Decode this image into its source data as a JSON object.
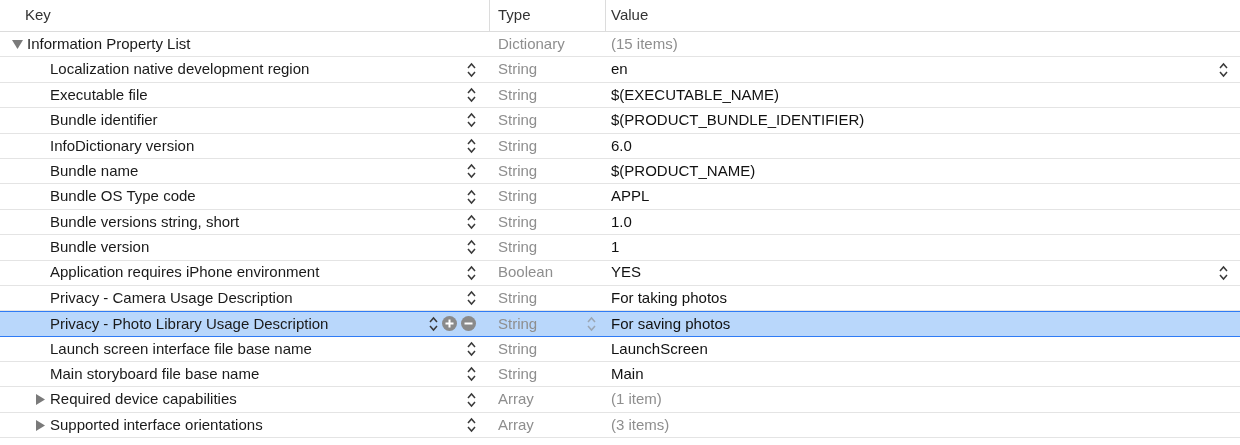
{
  "columns": [
    "Key",
    "Type",
    "Value"
  ],
  "root": {
    "key": "Information Property List",
    "type": "Dictionary",
    "value": "(15 items)",
    "expanded": true,
    "children": [
      {
        "key": "Localization native development region",
        "type": "String",
        "value": "en",
        "kind": "scalar",
        "selected": false,
        "value_popup": true
      },
      {
        "key": "Executable file",
        "type": "String",
        "value": "$(EXECUTABLE_NAME)",
        "kind": "scalar",
        "selected": false,
        "value_popup": false
      },
      {
        "key": "Bundle identifier",
        "type": "String",
        "value": "$(PRODUCT_BUNDLE_IDENTIFIER)",
        "kind": "scalar",
        "selected": false,
        "value_popup": false
      },
      {
        "key": "InfoDictionary version",
        "type": "String",
        "value": "6.0",
        "kind": "scalar",
        "selected": false,
        "value_popup": false
      },
      {
        "key": "Bundle name",
        "type": "String",
        "value": "$(PRODUCT_NAME)",
        "kind": "scalar",
        "selected": false,
        "value_popup": false
      },
      {
        "key": "Bundle OS Type code",
        "type": "String",
        "value": "APPL",
        "kind": "scalar",
        "selected": false,
        "value_popup": false
      },
      {
        "key": "Bundle versions string, short",
        "type": "String",
        "value": "1.0",
        "kind": "scalar",
        "selected": false,
        "value_popup": false
      },
      {
        "key": "Bundle version",
        "type": "String",
        "value": "1",
        "kind": "scalar",
        "selected": false,
        "value_popup": false
      },
      {
        "key": "Application requires iPhone environment",
        "type": "Boolean",
        "value": "YES",
        "kind": "scalar",
        "selected": false,
        "value_popup": true
      },
      {
        "key": "Privacy - Camera Usage Description",
        "type": "String",
        "value": "For taking photos",
        "kind": "scalar",
        "selected": false,
        "value_popup": false
      },
      {
        "key": "Privacy - Photo Library Usage Description",
        "type": "String",
        "value": "For saving photos",
        "kind": "scalar",
        "selected": true,
        "value_popup": false
      },
      {
        "key": "Launch screen interface file base name",
        "type": "String",
        "value": "LaunchScreen",
        "kind": "scalar",
        "selected": false,
        "value_popup": false
      },
      {
        "key": "Main storyboard file base name",
        "type": "String",
        "value": "Main",
        "kind": "scalar",
        "selected": false,
        "value_popup": false
      },
      {
        "key": "Required device capabilities",
        "type": "Array",
        "value": "(1 item)",
        "kind": "collection",
        "expanded": false,
        "selected": false,
        "value_popup": false
      },
      {
        "key": "Supported interface orientations",
        "type": "Array",
        "value": "(3 items)",
        "kind": "collection",
        "expanded": false,
        "selected": false,
        "value_popup": false
      }
    ]
  }
}
